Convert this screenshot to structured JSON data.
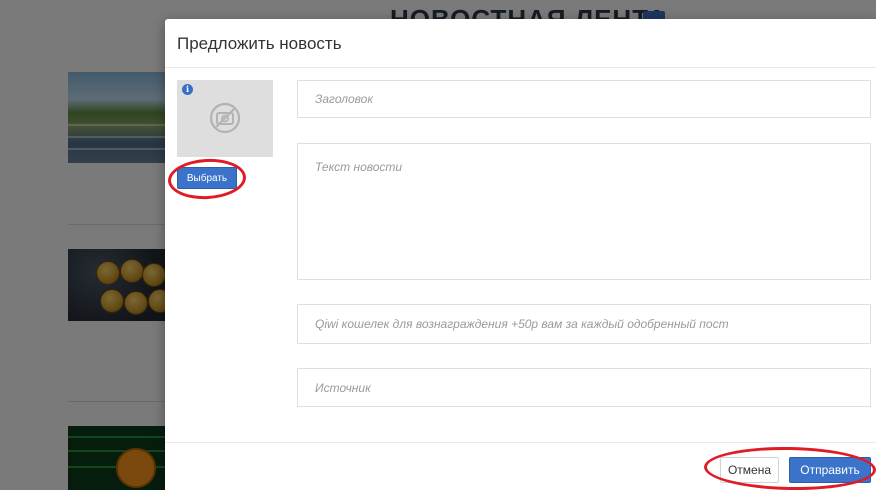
{
  "background": {
    "page_title": "НОВОСТНАЯ ЛЕНТА"
  },
  "modal": {
    "title": "Предложить новость",
    "image": {
      "info_icon": "info-icon",
      "placeholder_icon": "no-image-icon",
      "choose_label": "Выбрать"
    },
    "fields": {
      "title_placeholder": "Заголовок",
      "text_placeholder": "Текст новости",
      "qiwi_placeholder": "Qiwi кошелек для вознаграждения +50р вам за каждый одобренный пост",
      "source_placeholder": "Источник"
    },
    "footer": {
      "cancel_label": "Отмена",
      "send_label": "Отправить"
    }
  },
  "colors": {
    "accent": "#3a73c9",
    "annotation": "#e01b24"
  }
}
